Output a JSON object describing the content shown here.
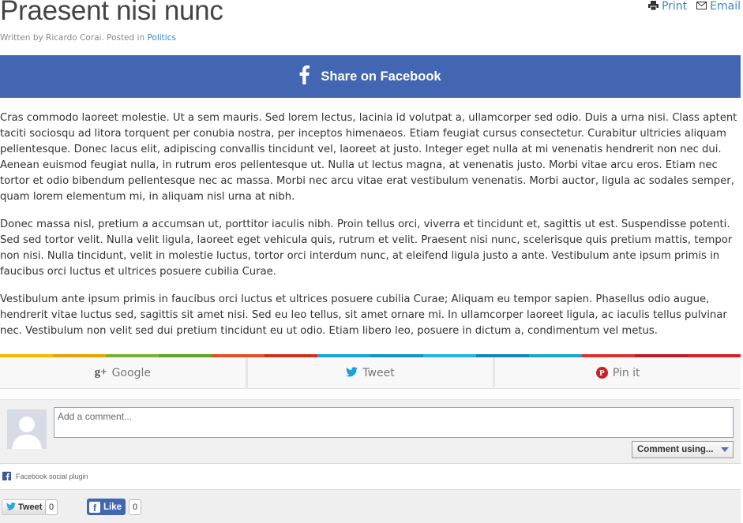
{
  "post": {
    "title": "Praesent nisi nunc",
    "byline_prefix": "Written by Ricardo Corai. Posted in ",
    "category": "Politics"
  },
  "tools": {
    "print_label": "Print",
    "email_label": "Email"
  },
  "facebook_share": {
    "label": "Share on Facebook",
    "color": "#4266b2"
  },
  "article": {
    "paragraphs": [
      "Cras commodo laoreet molestie. Ut a sem mauris. Sed lorem lectus, lacinia id volutpat a, ullamcorper sed odio. Duis a urna nisi. Class aptent taciti sociosqu ad litora torquent per conubia nostra, per inceptos himenaeos. Etiam feugiat cursus consectetur. Curabitur ultricies aliquam pellentesque. Donec lacus elit, adipiscing convallis tincidunt vel, laoreet at justo. Integer eget nulla at mi venenatis hendrerit non nec dui. Aenean euismod feugiat nulla, in rutrum eros pellentesque ut. Nulla ut lectus magna, at venenatis justo. Morbi vitae arcu eros. Etiam nec tortor et odio bibendum pellentesque nec ac massa. Morbi nec arcu vitae erat vestibulum venenatis. Morbi auctor, ligula ac sodales semper, quam lorem elementum mi, in aliquam nisl urna at nibh.",
      "Donec massa nisl, pretium a accumsan ut, porttitor iaculis nibh. Proin tellus orci, viverra et tincidunt et, sagittis ut est. Suspendisse potenti. Sed sed tortor velit. Nulla velit ligula, laoreet eget vehicula quis, rutrum et velit. Praesent nisi nunc, scelerisque quis pretium mattis, tempor non nisi. Nulla tincidunt, velit in molestie luctus, tortor orci interdum nunc, at eleifend ligula justo a ante. Vestibulum ante ipsum primis in faucibus orci luctus et ultrices posuere cubilia Curae.",
      "Vestibulum ante ipsum primis in faucibus orci luctus et ultrices posuere cubilia Curae; Aliquam eu tempor sapien. Phasellus odio augue, hendrerit vitae luctus sed, sagittis sit amet nisi. Sed eu leo tellus, sit amet ornare mi. In ullamcorper laoreet ligula, ac iaculis tellus pulvinar nec. Vestibulum non velit sed dui pretium tincidunt eu ut odio. Etiam libero leo, posuere in dictum a, condimentum vel metus."
    ]
  },
  "rainbow_colors": [
    "#f5b800",
    "#e3a500",
    "#7ab32e",
    "#5ea620",
    "#e04f26",
    "#c9321f",
    "#19a6d4",
    "#1495c1",
    "#20b8da",
    "#0f86b8",
    "#1aa7c7",
    "#d7332b",
    "#b91e23",
    "#d2232a"
  ],
  "share_buttons": {
    "google_label": "Google",
    "tweet_label": "Tweet",
    "pin_label": "Pin it",
    "google_icon_text": "g+",
    "pin_icon_text": "P"
  },
  "comments": {
    "placeholder": "Add a comment...",
    "comment_using_label": "Comment using...",
    "plugin_label": "Facebook social plugin"
  },
  "social_bar": {
    "tweet_label": "Tweet",
    "tweet_count": "0",
    "like_label": "Like",
    "like_count": "0"
  }
}
